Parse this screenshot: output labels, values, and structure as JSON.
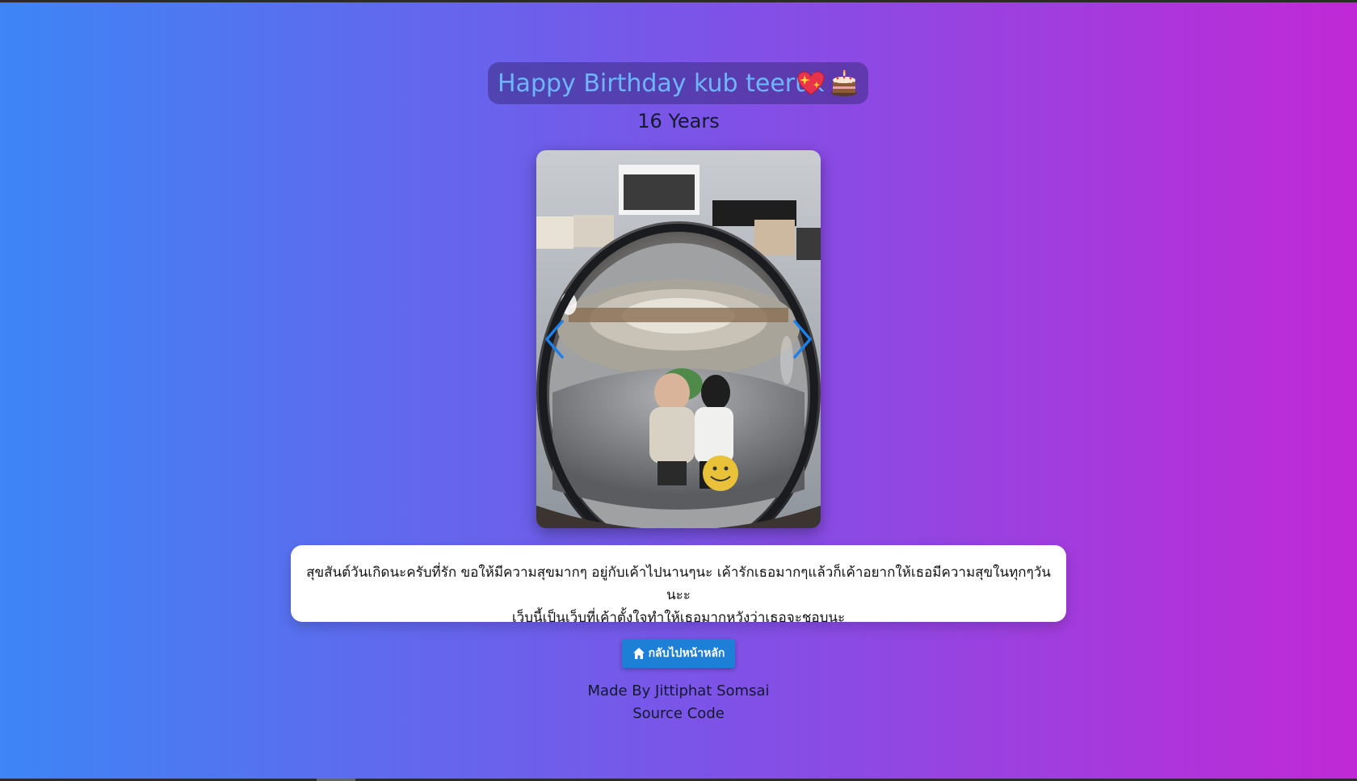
{
  "header": {
    "title": "Happy Birthday kub teeruk",
    "subtitle": "16 Years"
  },
  "carousel": {
    "prev_icon": "chevron-left-icon",
    "next_icon": "chevron-right-icon"
  },
  "message": {
    "line1": "สุขสันต์วันเกิดนะครับที่รัก ขอให้มีความสุขมากๆ อยู่กับเค้าไปนานๆนะ เค้ารักเธอมากๆแล้วก็เค้าอยากให้เธอมีความสุขในทุกๆวันนะะ",
    "line2": "เว็บนี้เป็นเว็บที่เค้าตั้งใจทำให้เธอมากหวังว่าเธอจะชอบนะ"
  },
  "home_button": {
    "label": "กลับไปหน้าหลัก",
    "icon": "home-icon"
  },
  "footer": {
    "author": "Made By Jittiphat Somsai",
    "source": "Source Code"
  },
  "colors": {
    "gradient_start": "#3d85f6",
    "gradient_end": "#c029d6",
    "title_text": "#6eb6ff",
    "button": "#1d7fd6"
  }
}
